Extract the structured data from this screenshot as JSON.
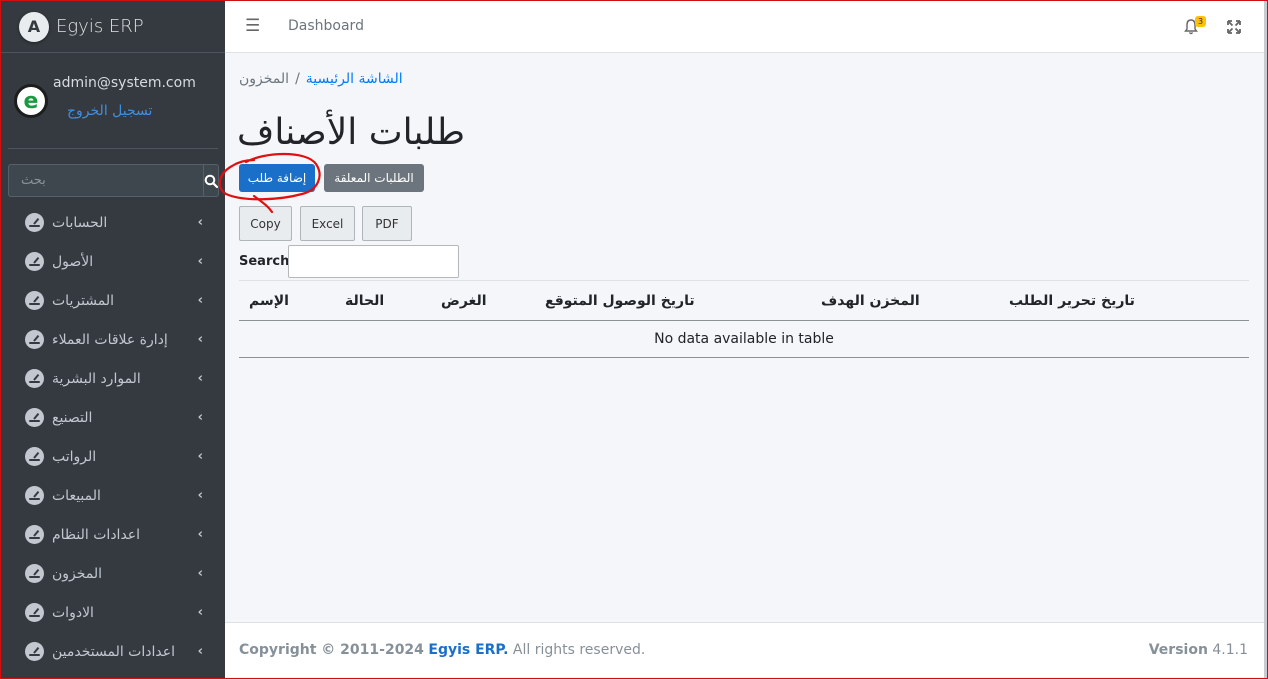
{
  "app": {
    "brand": "Egyis ERP",
    "logo_letter": "A"
  },
  "user": {
    "email": "admin@system.com",
    "logout": "تسجيل الخروج",
    "avatar_letter": "e"
  },
  "sidebar": {
    "search_placeholder": "بحث",
    "items": [
      {
        "label": "الحسابات"
      },
      {
        "label": "الأصول"
      },
      {
        "label": "المشتريات"
      },
      {
        "label": "إدارة علاقات العملاء"
      },
      {
        "label": "الموارد البشرية"
      },
      {
        "label": "التصنيع"
      },
      {
        "label": "الرواتب"
      },
      {
        "label": "المبيعات"
      },
      {
        "label": "اعدادات النظام"
      },
      {
        "label": "المخزون"
      },
      {
        "label": "الادوات"
      },
      {
        "label": "اعدادات المستخدمين"
      }
    ]
  },
  "topbar": {
    "dashboard": "Dashboard",
    "notification_count": "3"
  },
  "breadcrumb": {
    "home": "الشاشة الرئيسية",
    "separator": "/",
    "current": "المخزون"
  },
  "page": {
    "title": "طلبات الأصناف",
    "add_button": "إضافة طلب",
    "pending_button": "الطلبات المعلقة",
    "export": {
      "copy": "Copy",
      "excel": "Excel",
      "pdf": "PDF"
    },
    "search_label": "Search:"
  },
  "table": {
    "columns": {
      "date_created": "تاريخ تحرير الطلب",
      "target_store": "المخزن الهدف",
      "expected_arrival": "تاريخ الوصول المتوقع",
      "purpose": "الغرض",
      "status": "الحالة",
      "name": "الإسم"
    },
    "empty": "No data available in table"
  },
  "footer": {
    "copyright_prefix": "Copyright © 2011-2024",
    "copyright_brand": "Egyis ERP.",
    "copyright_suffix": "All rights reserved.",
    "version_label": "Version",
    "version_value": "4.1.1"
  },
  "colors": {
    "sidebar": "#343a40",
    "primary": "#1a6fc9",
    "secondary": "#6c757d",
    "annotation": "#e01010"
  }
}
